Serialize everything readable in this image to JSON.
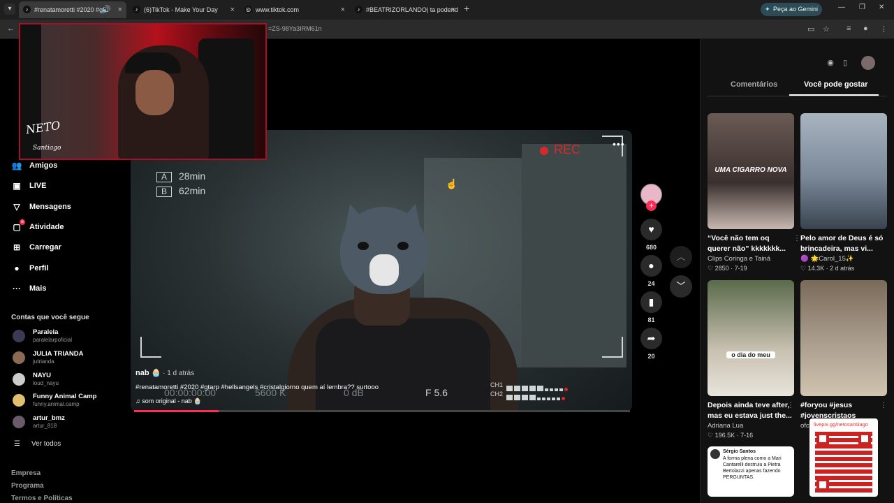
{
  "browser": {
    "tabs": [
      {
        "title": "#renatamoretti #2020 #gta",
        "active": true
      },
      {
        "title": "(6)TikTok - Make Your Day",
        "active": false
      },
      {
        "title": "www.tiktok.com",
        "active": false
      },
      {
        "title": "#BEATRIZORLANDO| ta podend",
        "active": false
      }
    ],
    "gemini_label": "Peça ao Gemini",
    "url_fragment": "=ZS-98Ya3IRM61n"
  },
  "sidebar": {
    "nav": [
      {
        "label": "Amigos",
        "icon": "friends-icon"
      },
      {
        "label": "LIVE",
        "icon": "live-icon"
      },
      {
        "label": "Mensagens",
        "icon": "messages-icon"
      },
      {
        "label": "Atividade",
        "icon": "activity-icon",
        "badge": "6"
      },
      {
        "label": "Carregar",
        "icon": "upload-icon"
      },
      {
        "label": "Perfil",
        "icon": "profile-icon"
      },
      {
        "label": "Mais",
        "icon": "more-icon"
      }
    ],
    "following_title": "Contas que você segue",
    "following": [
      {
        "name": "Paralela",
        "handle": "paralelarpoficial"
      },
      {
        "name": "JULIA TRIANDA",
        "handle": "jutrianda"
      },
      {
        "name": "NAYU",
        "handle": "loud_nayu"
      },
      {
        "name": "Funny Animal Camp",
        "handle": "funny.animal.camp"
      },
      {
        "name": "artur_bmz",
        "handle": "artur_818"
      }
    ],
    "see_all": "Ver todos",
    "footer": [
      "Empresa",
      "Programa",
      "Termos e Políticas"
    ]
  },
  "webcam": {
    "logo_line1": "NETO",
    "logo_line2": "Santiago"
  },
  "video": {
    "rec_label": "REC",
    "timer_a_label": "A",
    "timer_a": "28min",
    "timer_b_label": "B",
    "timer_b": "62min",
    "timecode": "00:00:00:00",
    "kelvin": "5600 K",
    "db": "0 dB",
    "fstop": "F 5.6",
    "ch1": "CH1",
    "ch2": "CH2",
    "author": "nab 🧁",
    "ago": " · 1 d atrás",
    "caption": "#renatamoretti #2020 #gtarp #hellsangels #cristalgiorno quem aí lembra?? surtooo",
    "sound": "♫  som original - nab 🧁",
    "progress": 0.17
  },
  "actions": {
    "likes": "680",
    "comments": "24",
    "saves": "81",
    "shares": "20"
  },
  "right_panel": {
    "tab_comments": "Comentários",
    "tab_suggested": "Você pode gostar",
    "cards": [
      {
        "title": "“Você não tem oq querer não” kkkkkkk...",
        "author": "Clips Coringa e Tainá",
        "stats": "♡ 2850 · 7-19",
        "overlay": "UMA CIGARRO NOVA"
      },
      {
        "title": "Pelo amor de Deus é só brincadeira, mas vi...",
        "author": "🟣 🌟Carol_15✨",
        "stats": "♡ 14.3K · 2 d atrás",
        "overlay": ""
      },
      {
        "title": "Depois ainda teve after, mas eu estava just the...",
        "author": "Adriana Lua",
        "stats": "♡ 196.5K · 7-16",
        "overlay": "o dia do meu"
      },
      {
        "title": "#foryou #jesus #jovenscristaos",
        "author": "ofc",
        "stats": "",
        "overlay": ""
      }
    ],
    "tweet_name": "Sérgio Santos",
    "tweet_text": "A forma plena como a Mari Cantarelli destruiu a Pietra Bertolazzi apenas fazendo PERGUNTAS.",
    "livepix_url": "livepix.gg/netosantiiago"
  },
  "colors": {
    "accent": "#fe2c55",
    "rec": "#d42a2a"
  }
}
